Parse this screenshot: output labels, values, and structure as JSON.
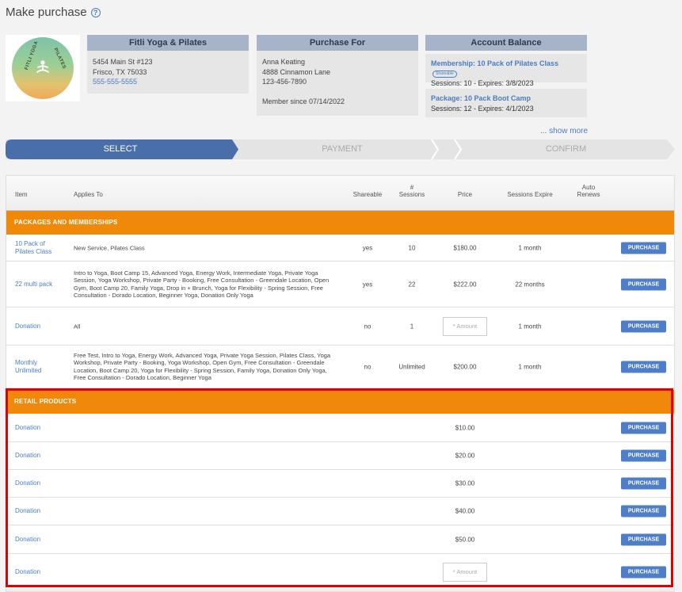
{
  "page": {
    "title": "Make purchase",
    "help_icon": "question-circle-icon"
  },
  "business": {
    "header": "Fitli Yoga & Pilates",
    "address1": "5454 Main St #123",
    "address2": "Frisco, TX 75033",
    "phone": "555-555-5555",
    "logo_text_left": "FITLI YOGA",
    "logo_text_right": "PILATES"
  },
  "purchase_for": {
    "header": "Purchase For",
    "name": "Anna Keating",
    "street": "4888 Cinnamon Lane",
    "phone": "123-456-7890",
    "member_since": "Member since 07/14/2022"
  },
  "account_balance": {
    "header": "Account Balance",
    "items": [
      {
        "title": "Membership: 10 Pack of Pilates Class",
        "badge": "Shareable",
        "detail": "Sessions: 10 -  Expires: 3/8/2023"
      },
      {
        "title": "Package: 10 Pack Boot Camp",
        "badge": "",
        "detail": "Sessions: 12 -  Expires: 4/1/2023"
      }
    ],
    "show_more": "... show more"
  },
  "steps": [
    {
      "label": "SELECT",
      "active": true
    },
    {
      "label": "PAYMENT",
      "active": false
    },
    {
      "label": "CONFIRM",
      "active": false
    }
  ],
  "table": {
    "columns": {
      "item": "Item",
      "applies_to": "Applies To",
      "shareable": "Shareable",
      "sessions_hash": "#",
      "sessions": "Sessions",
      "price": "Price",
      "expire": "Sessions Expire",
      "auto1": "Auto",
      "auto2": "Renews"
    },
    "packages_header": "PACKAGES AND MEMBERSHIPS",
    "packages": [
      {
        "item": "10 Pack of Pilates Class",
        "applies_to": "New Service, Pilates Class",
        "shareable": "yes",
        "sessions": "10",
        "price": "$180.00",
        "expire": "1 month",
        "button": "PURCHASE"
      },
      {
        "item": "22 multi pack",
        "applies_to": "Intro to Yoga, Boot Camp 15, Advanced Yoga, Energy Work, Intermediate Yoga, Private Yoga Session, Yoga Workshop, Private Party - Booking, Free Consultation - Greendale Location, Open Gym, Boot Camp 20, Family Yoga, Drop in + Brunch, Yoga for Flexibility - Spring Session, Free Consultation - Dorado Location, Beginner Yoga, Donation Only Yoga",
        "shareable": "yes",
        "sessions": "22",
        "price": "$222.00",
        "expire": "22 months",
        "button": "PURCHASE"
      },
      {
        "item": "Donation",
        "applies_to": "All",
        "shareable": "no",
        "sessions": "1",
        "price_placeholder": "* Amount",
        "expire": "1 month",
        "button": "PURCHASE"
      },
      {
        "item": "Monthly Unlimited",
        "applies_to": "Free Test, Intro to Yoga, Energy Work, Advanced Yoga, Private Yoga Session, Pilates Class, Yoga Workshop, Private Party - Booking, Yoga Workshop, Open Gym, Free Consultation - Greendale Location, Boot Camp 20, Yoga for Flexibility - Spring Session, Family Yoga, Donation Only Yoga, Free Consultation - Dorado Location, Beginner Yoga",
        "shareable": "no",
        "sessions": "Unlimited",
        "price": "$200.00",
        "expire": "1 month",
        "button": "PURCHASE"
      }
    ],
    "retail_header": "RETAIL PRODUCTS",
    "retail": [
      {
        "item": "Donation",
        "price": "$10.00",
        "button": "PURCHASE"
      },
      {
        "item": "Donation",
        "price": "$20.00",
        "button": "PURCHASE"
      },
      {
        "item": "Donation",
        "price": "$30.00",
        "button": "PURCHASE"
      },
      {
        "item": "Donation",
        "price": "$40.00",
        "button": "PURCHASE"
      },
      {
        "item": "Donation",
        "price": "$50.00",
        "button": "PURCHASE"
      },
      {
        "item": "Donation",
        "price_placeholder": "* Amount",
        "button": "PURCHASE"
      }
    ]
  },
  "colors": {
    "accent": "#4f7ec8",
    "section": "#f0890a",
    "highlight": "#e10000",
    "step_active": "#4a6ea9"
  }
}
